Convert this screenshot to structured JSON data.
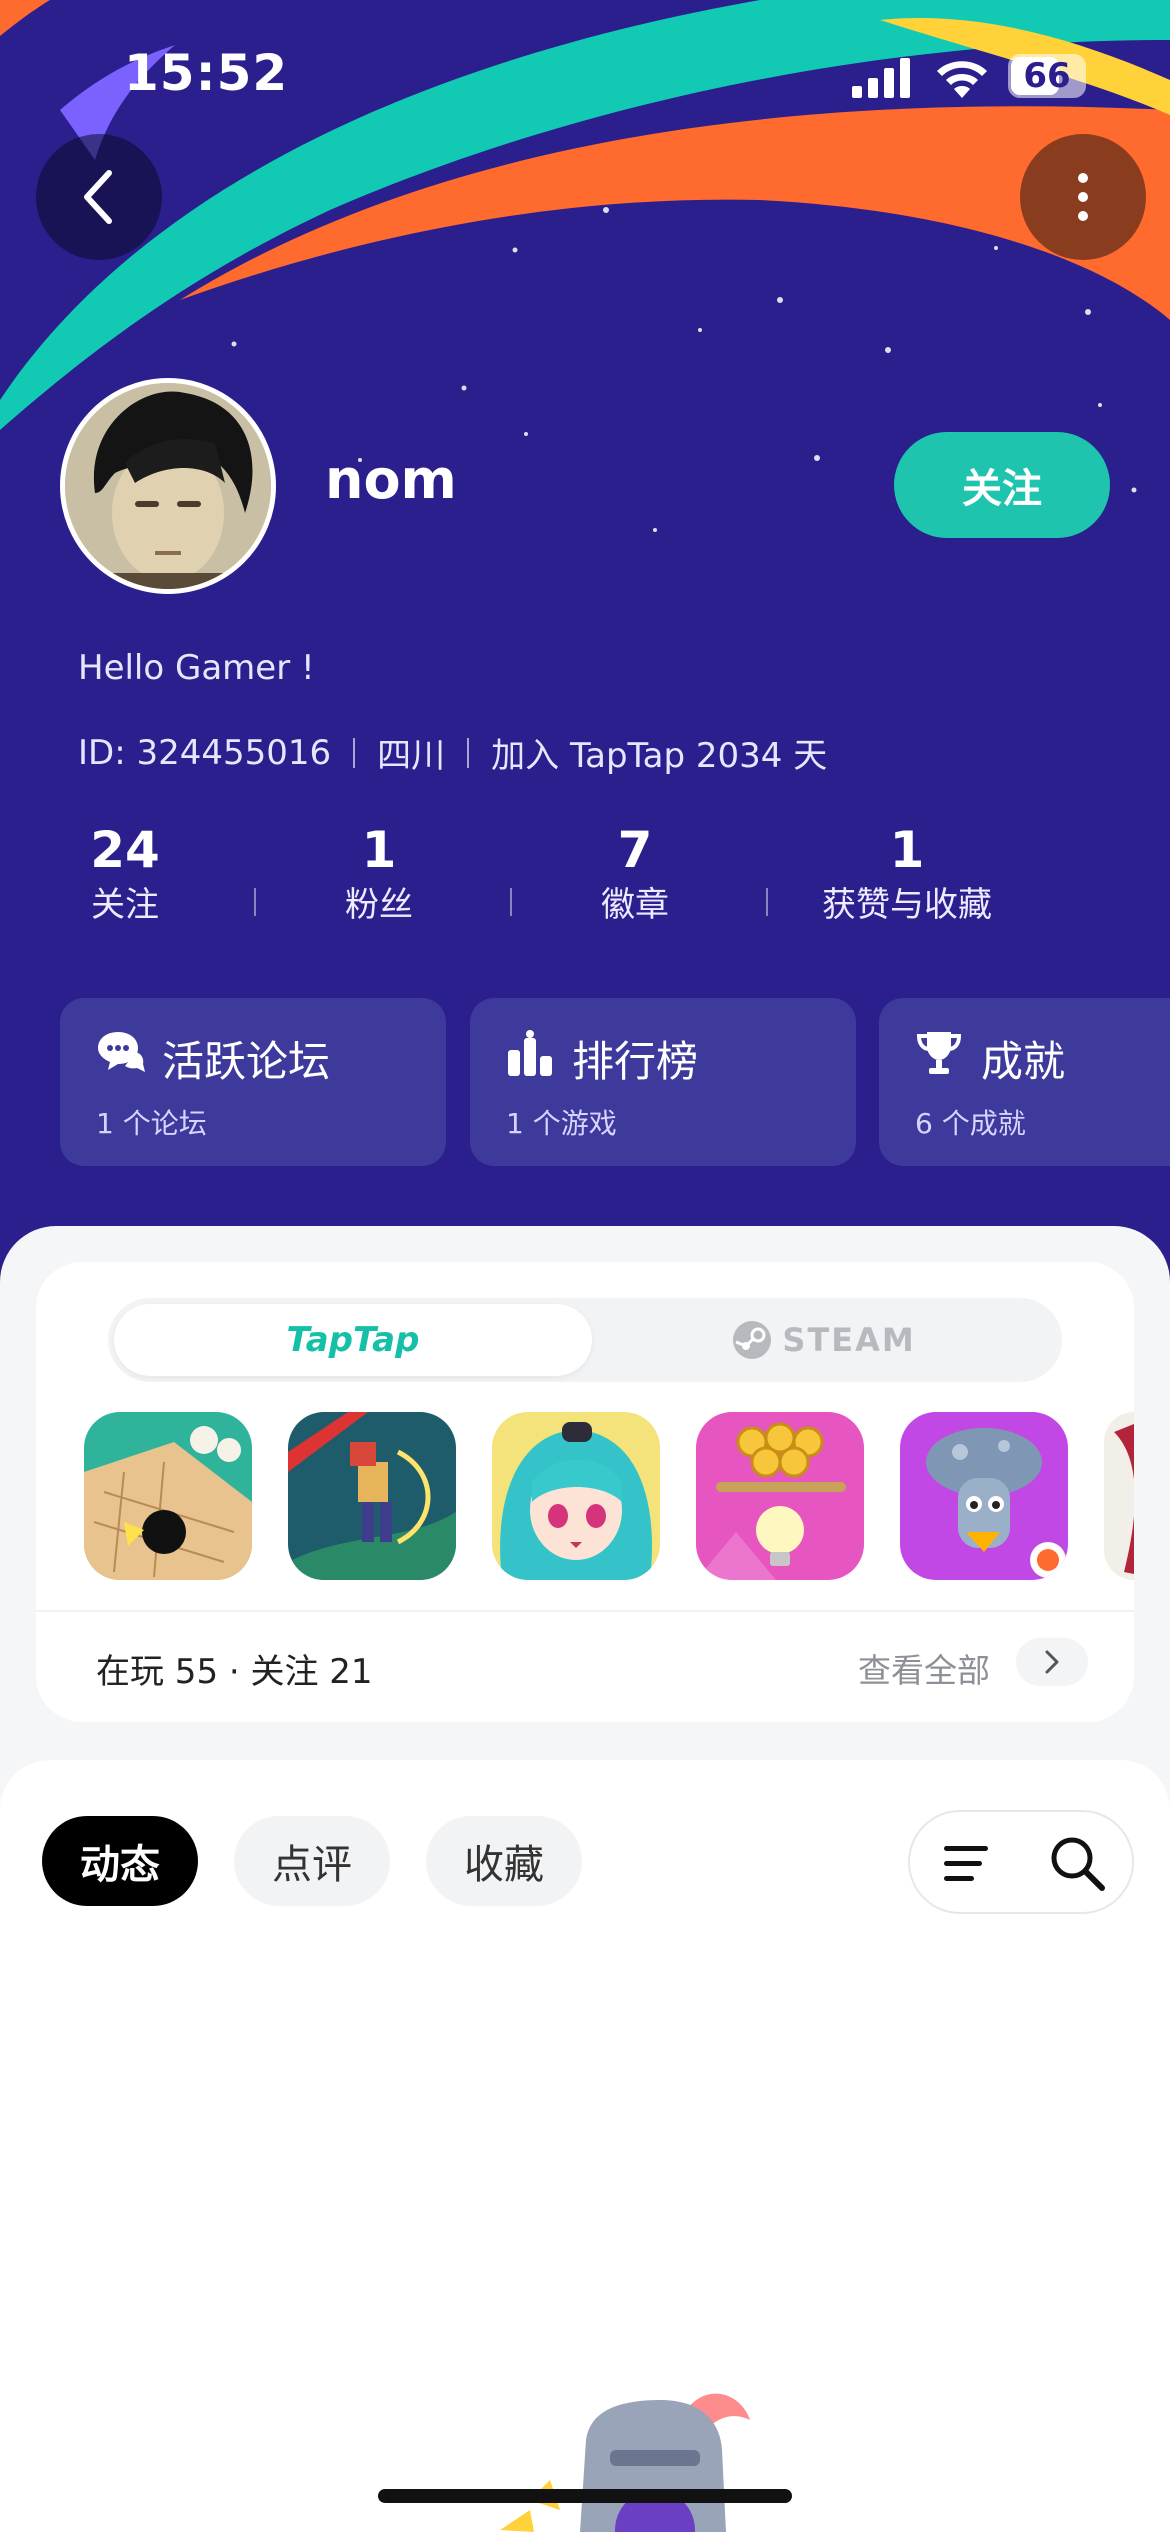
{
  "status_bar": {
    "time": "15:52",
    "battery": "66",
    "battery_level": 0.66
  },
  "nav": {
    "back_icon": "chevron-left-icon",
    "more_icon": "more-vertical-icon"
  },
  "profile": {
    "username": "nom",
    "follow_label": "关注",
    "bio": "Hello Gamer !",
    "id_text": "ID: 324455016",
    "location": "四川",
    "joined": "加入 TapTap 2034 天"
  },
  "stats": [
    {
      "value": "24",
      "label": "关注"
    },
    {
      "value": "1",
      "label": "粉丝"
    },
    {
      "value": "7",
      "label": "徽章"
    },
    {
      "value": "1",
      "label": "获赞与收藏"
    }
  ],
  "cards": [
    {
      "title": "活跃论坛",
      "subtitle": "1 个论坛",
      "icon": "forum-chat-icon"
    },
    {
      "title": "排行榜",
      "subtitle": "1 个游戏",
      "icon": "ranking-icon"
    },
    {
      "title": "成就",
      "subtitle": "6 个成就",
      "icon": "trophy-icon"
    }
  ],
  "games": {
    "platforms": {
      "active": "TapTap",
      "other": "STEAM"
    },
    "count_text": "在玩 55 · 关注 21",
    "see_all": "查看全部",
    "icons": [
      "go-game-icon",
      "pixel-hero-game-icon",
      "anime-girl-game-icon",
      "coin-puzzle-game-icon",
      "mushroom-character-game-icon",
      "partial-game-icon"
    ]
  },
  "feed_tabs": [
    "动态",
    "点评",
    "收藏"
  ],
  "tools": {
    "filter_icon": "filter-lines-icon",
    "search_icon": "search-icon"
  },
  "colors": {
    "hero_bg": "#2a1f8c",
    "accent": "#1ec4ad",
    "orange_swoosh": "#ff6a2e",
    "teal_swoosh": "#12c9b3"
  }
}
